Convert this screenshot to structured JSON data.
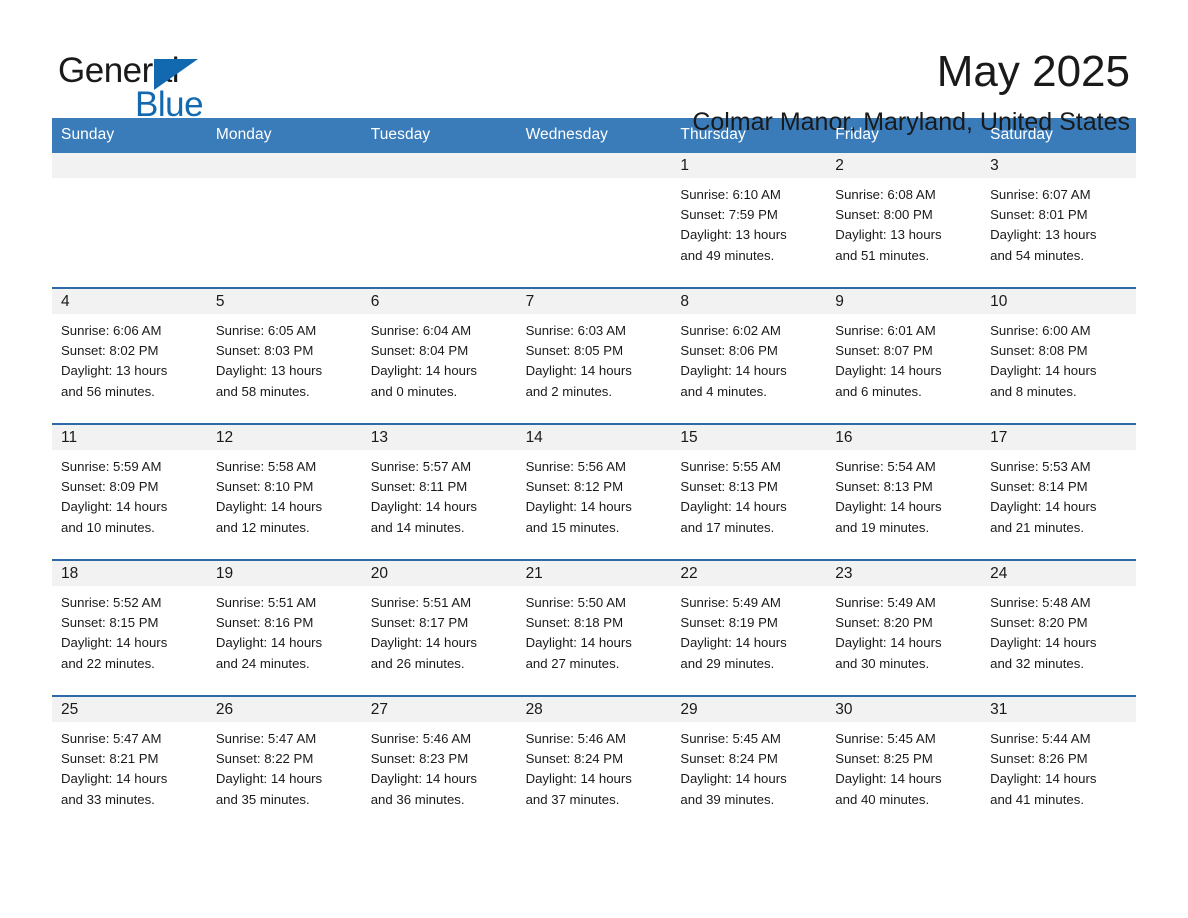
{
  "brand": {
    "line1": "General",
    "line2": "Blue",
    "flag_color": "#1269b0"
  },
  "header": {
    "month_title": "May 2025",
    "location": "Colmar Manor, Maryland, United States"
  },
  "theme": {
    "header_bar": "#3a7cba",
    "row_divider": "#2a6ba8",
    "daynum_band": "#f2f2f2",
    "text": "#1a1a1a"
  },
  "labels": {
    "sunrise_prefix": "Sunrise:",
    "sunset_prefix": "Sunset:",
    "daylight_prefix": "Daylight:"
  },
  "weekdays": [
    "Sunday",
    "Monday",
    "Tuesday",
    "Wednesday",
    "Thursday",
    "Friday",
    "Saturday"
  ],
  "weeks": [
    [
      {
        "empty": true
      },
      {
        "empty": true
      },
      {
        "empty": true
      },
      {
        "empty": true
      },
      {
        "day": "1",
        "sunrise": "Sunrise: 6:10 AM",
        "sunset": "Sunset: 7:59 PM",
        "daylight_l1": "Daylight: 13 hours",
        "daylight_l2": "and 49 minutes."
      },
      {
        "day": "2",
        "sunrise": "Sunrise: 6:08 AM",
        "sunset": "Sunset: 8:00 PM",
        "daylight_l1": "Daylight: 13 hours",
        "daylight_l2": "and 51 minutes."
      },
      {
        "day": "3",
        "sunrise": "Sunrise: 6:07 AM",
        "sunset": "Sunset: 8:01 PM",
        "daylight_l1": "Daylight: 13 hours",
        "daylight_l2": "and 54 minutes."
      }
    ],
    [
      {
        "day": "4",
        "sunrise": "Sunrise: 6:06 AM",
        "sunset": "Sunset: 8:02 PM",
        "daylight_l1": "Daylight: 13 hours",
        "daylight_l2": "and 56 minutes."
      },
      {
        "day": "5",
        "sunrise": "Sunrise: 6:05 AM",
        "sunset": "Sunset: 8:03 PM",
        "daylight_l1": "Daylight: 13 hours",
        "daylight_l2": "and 58 minutes."
      },
      {
        "day": "6",
        "sunrise": "Sunrise: 6:04 AM",
        "sunset": "Sunset: 8:04 PM",
        "daylight_l1": "Daylight: 14 hours",
        "daylight_l2": "and 0 minutes."
      },
      {
        "day": "7",
        "sunrise": "Sunrise: 6:03 AM",
        "sunset": "Sunset: 8:05 PM",
        "daylight_l1": "Daylight: 14 hours",
        "daylight_l2": "and 2 minutes."
      },
      {
        "day": "8",
        "sunrise": "Sunrise: 6:02 AM",
        "sunset": "Sunset: 8:06 PM",
        "daylight_l1": "Daylight: 14 hours",
        "daylight_l2": "and 4 minutes."
      },
      {
        "day": "9",
        "sunrise": "Sunrise: 6:01 AM",
        "sunset": "Sunset: 8:07 PM",
        "daylight_l1": "Daylight: 14 hours",
        "daylight_l2": "and 6 minutes."
      },
      {
        "day": "10",
        "sunrise": "Sunrise: 6:00 AM",
        "sunset": "Sunset: 8:08 PM",
        "daylight_l1": "Daylight: 14 hours",
        "daylight_l2": "and 8 minutes."
      }
    ],
    [
      {
        "day": "11",
        "sunrise": "Sunrise: 5:59 AM",
        "sunset": "Sunset: 8:09 PM",
        "daylight_l1": "Daylight: 14 hours",
        "daylight_l2": "and 10 minutes."
      },
      {
        "day": "12",
        "sunrise": "Sunrise: 5:58 AM",
        "sunset": "Sunset: 8:10 PM",
        "daylight_l1": "Daylight: 14 hours",
        "daylight_l2": "and 12 minutes."
      },
      {
        "day": "13",
        "sunrise": "Sunrise: 5:57 AM",
        "sunset": "Sunset: 8:11 PM",
        "daylight_l1": "Daylight: 14 hours",
        "daylight_l2": "and 14 minutes."
      },
      {
        "day": "14",
        "sunrise": "Sunrise: 5:56 AM",
        "sunset": "Sunset: 8:12 PM",
        "daylight_l1": "Daylight: 14 hours",
        "daylight_l2": "and 15 minutes."
      },
      {
        "day": "15",
        "sunrise": "Sunrise: 5:55 AM",
        "sunset": "Sunset: 8:13 PM",
        "daylight_l1": "Daylight: 14 hours",
        "daylight_l2": "and 17 minutes."
      },
      {
        "day": "16",
        "sunrise": "Sunrise: 5:54 AM",
        "sunset": "Sunset: 8:13 PM",
        "daylight_l1": "Daylight: 14 hours",
        "daylight_l2": "and 19 minutes."
      },
      {
        "day": "17",
        "sunrise": "Sunrise: 5:53 AM",
        "sunset": "Sunset: 8:14 PM",
        "daylight_l1": "Daylight: 14 hours",
        "daylight_l2": "and 21 minutes."
      }
    ],
    [
      {
        "day": "18",
        "sunrise": "Sunrise: 5:52 AM",
        "sunset": "Sunset: 8:15 PM",
        "daylight_l1": "Daylight: 14 hours",
        "daylight_l2": "and 22 minutes."
      },
      {
        "day": "19",
        "sunrise": "Sunrise: 5:51 AM",
        "sunset": "Sunset: 8:16 PM",
        "daylight_l1": "Daylight: 14 hours",
        "daylight_l2": "and 24 minutes."
      },
      {
        "day": "20",
        "sunrise": "Sunrise: 5:51 AM",
        "sunset": "Sunset: 8:17 PM",
        "daylight_l1": "Daylight: 14 hours",
        "daylight_l2": "and 26 minutes."
      },
      {
        "day": "21",
        "sunrise": "Sunrise: 5:50 AM",
        "sunset": "Sunset: 8:18 PM",
        "daylight_l1": "Daylight: 14 hours",
        "daylight_l2": "and 27 minutes."
      },
      {
        "day": "22",
        "sunrise": "Sunrise: 5:49 AM",
        "sunset": "Sunset: 8:19 PM",
        "daylight_l1": "Daylight: 14 hours",
        "daylight_l2": "and 29 minutes."
      },
      {
        "day": "23",
        "sunrise": "Sunrise: 5:49 AM",
        "sunset": "Sunset: 8:20 PM",
        "daylight_l1": "Daylight: 14 hours",
        "daylight_l2": "and 30 minutes."
      },
      {
        "day": "24",
        "sunrise": "Sunrise: 5:48 AM",
        "sunset": "Sunset: 8:20 PM",
        "daylight_l1": "Daylight: 14 hours",
        "daylight_l2": "and 32 minutes."
      }
    ],
    [
      {
        "day": "25",
        "sunrise": "Sunrise: 5:47 AM",
        "sunset": "Sunset: 8:21 PM",
        "daylight_l1": "Daylight: 14 hours",
        "daylight_l2": "and 33 minutes."
      },
      {
        "day": "26",
        "sunrise": "Sunrise: 5:47 AM",
        "sunset": "Sunset: 8:22 PM",
        "daylight_l1": "Daylight: 14 hours",
        "daylight_l2": "and 35 minutes."
      },
      {
        "day": "27",
        "sunrise": "Sunrise: 5:46 AM",
        "sunset": "Sunset: 8:23 PM",
        "daylight_l1": "Daylight: 14 hours",
        "daylight_l2": "and 36 minutes."
      },
      {
        "day": "28",
        "sunrise": "Sunrise: 5:46 AM",
        "sunset": "Sunset: 8:24 PM",
        "daylight_l1": "Daylight: 14 hours",
        "daylight_l2": "and 37 minutes."
      },
      {
        "day": "29",
        "sunrise": "Sunrise: 5:45 AM",
        "sunset": "Sunset: 8:24 PM",
        "daylight_l1": "Daylight: 14 hours",
        "daylight_l2": "and 39 minutes."
      },
      {
        "day": "30",
        "sunrise": "Sunrise: 5:45 AM",
        "sunset": "Sunset: 8:25 PM",
        "daylight_l1": "Daylight: 14 hours",
        "daylight_l2": "and 40 minutes."
      },
      {
        "day": "31",
        "sunrise": "Sunrise: 5:44 AM",
        "sunset": "Sunset: 8:26 PM",
        "daylight_l1": "Daylight: 14 hours",
        "daylight_l2": "and 41 minutes."
      }
    ]
  ]
}
